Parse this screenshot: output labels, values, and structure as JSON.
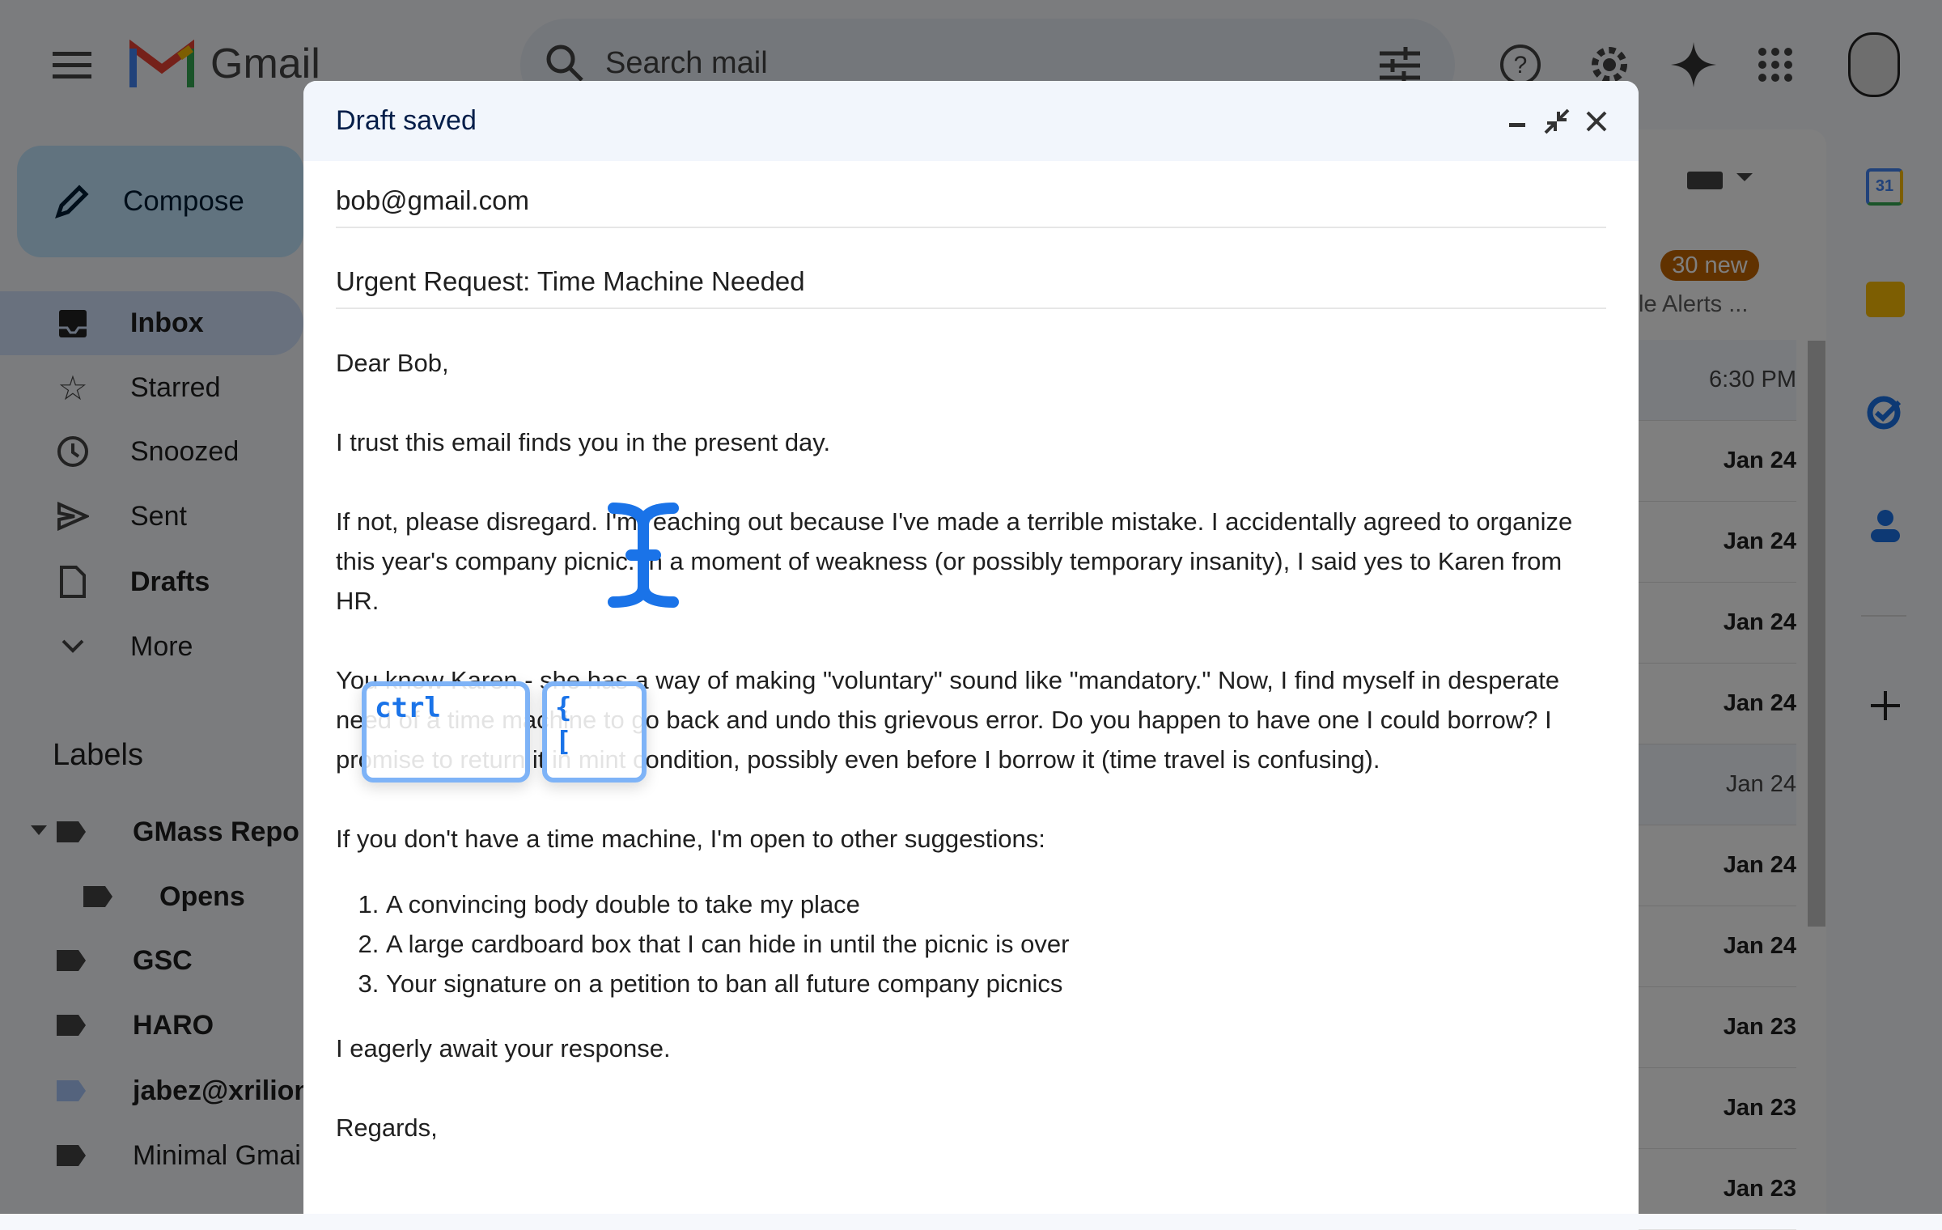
{
  "header": {
    "app_name": "Gmail",
    "search_placeholder": "Search mail",
    "icons": [
      "menu-icon",
      "search-icon",
      "tune-icon",
      "help-icon",
      "settings-icon",
      "gemini-sparkle-icon",
      "apps-grid-icon",
      "avatar"
    ]
  },
  "sidebar": {
    "compose_label": "Compose",
    "items": [
      {
        "label": "Inbox",
        "icon": "inbox-icon",
        "bold": true,
        "active": true
      },
      {
        "label": "Starred",
        "icon": "star-icon"
      },
      {
        "label": "Snoozed",
        "icon": "clock-icon"
      },
      {
        "label": "Sent",
        "icon": "send-icon"
      },
      {
        "label": "Drafts",
        "icon": "draft-icon",
        "bold": true
      },
      {
        "label": "More",
        "icon": "chevron-down-icon"
      }
    ],
    "labels_heading": "Labels",
    "labels": [
      {
        "label": "GMass Repo"
      },
      {
        "label": "Opens"
      },
      {
        "label": "GSC"
      },
      {
        "label": "HARO"
      },
      {
        "label": "jabez@xrilion"
      },
      {
        "label": "Minimal Gmai"
      }
    ]
  },
  "list": {
    "badge": "30 new",
    "category_snippet": "le Alerts ...",
    "dates": [
      "6:30 PM",
      "Jan 24",
      "Jan 24",
      "Jan 24",
      "Jan 24",
      "Jan 24",
      "Jan 24",
      "Jan 24",
      "Jan 23",
      "Jan 23",
      "Jan 23"
    ]
  },
  "side_apps": [
    "calendar-icon",
    "keep-icon",
    "tasks-icon",
    "contacts-icon",
    "add-icon"
  ],
  "compose": {
    "status": "Draft saved",
    "to": "bob@gmail.com",
    "subject": "Urgent Request: Time Machine Needed",
    "greeting": "Dear Bob,",
    "p1": "I trust this email finds you in the present day.",
    "p2": "If not, please disregard. I'm reaching out because I've made a terrible mistake. I accidentally agreed to organize this year's company picnic. In a moment of weakness (or possibly temporary insanity), I said yes to Karen from HR.",
    "p3": "You know Karen - she has a way of making \"voluntary\" sound like \"mandatory.\" Now, I find myself in desperate need of a time machine to go back and undo this grievous error. Do you happen to have one I could borrow? I promise to return it in mint condition, possibly even before I borrow it (time travel is confusing).",
    "p4": "If you don't have a time machine, I'm open to other suggestions:",
    "list": [
      "A convincing body double to take my place",
      "A large cardboard box that I can hide in until the picnic is over",
      "Your signature on a petition to ban all future company picnics"
    ],
    "p5": "I eagerly await your response.",
    "closing": "Regards,"
  },
  "keys": {
    "key1": "ctrl",
    "key2_top": "{",
    "key2_bottom": "["
  },
  "colors": {
    "accent": "#1a73e8",
    "badge": "#c26401",
    "compose_header": "#f2f6fc"
  }
}
